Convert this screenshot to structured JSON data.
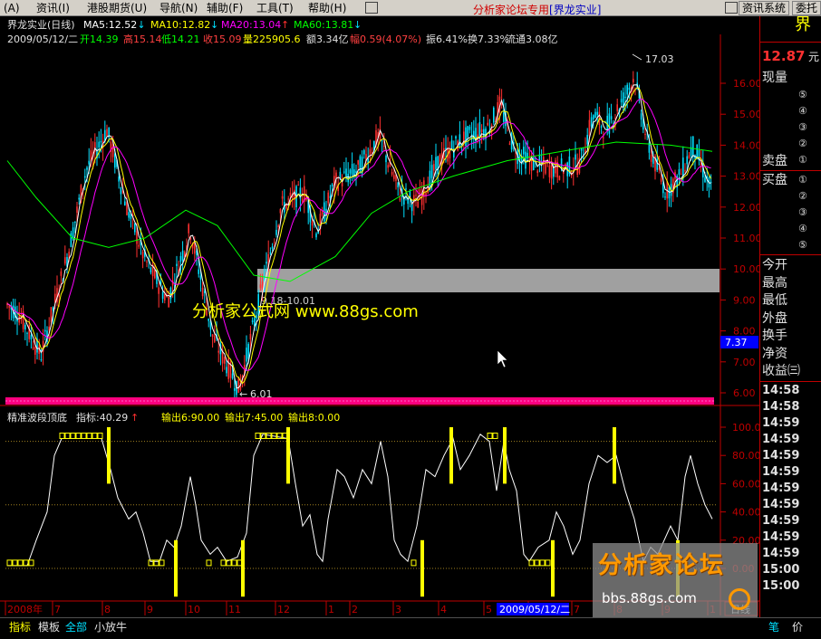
{
  "menubar": {
    "items": [
      {
        "key": "A",
        "label": "(A)"
      },
      {
        "key": "I",
        "label": "资讯(I)"
      },
      {
        "key": "U",
        "label": "港股期货(U)"
      },
      {
        "key": "N",
        "label": "导航(N)"
      },
      {
        "key": "F",
        "label": "辅助(F)"
      },
      {
        "key": "T",
        "label": "工具(T)"
      },
      {
        "key": "H",
        "label": "帮助(H)"
      }
    ],
    "title_main": "分析家论坛专用",
    "title_stock": "[界龙实业]",
    "btn_info": "资讯系统",
    "btn_delegate": "委托"
  },
  "header": {
    "stock_line": "界龙实业(日线)",
    "ma": [
      {
        "label": "MA5:12.52",
        "arrow": "↓",
        "color": "#ffffff"
      },
      {
        "label": "MA10:12.82",
        "arrow": "↓",
        "color": "#ffff00"
      },
      {
        "label": "MA20:13.04",
        "arrow": "↑",
        "color": "#ff00ff"
      },
      {
        "label": "MA60:13.81",
        "arrow": "↓",
        "color": "#00ff00"
      }
    ],
    "quote": [
      {
        "t": "2009/05/12/二",
        "c": "#e0e0e0"
      },
      {
        "t": "开14.39",
        "c": "#00ff00"
      },
      {
        "t": "高15.14",
        "c": "#ff4040"
      },
      {
        "t": "低14.21",
        "c": "#00ff00"
      },
      {
        "t": "收15.09",
        "c": "#ff4040"
      },
      {
        "t": "量225905.6",
        "c": "#ffff00"
      },
      {
        "t": "额3.34亿",
        "c": "#e0e0e0"
      },
      {
        "t": "幅0.59(4.07%)",
        "c": "#ff4040"
      },
      {
        "t": "振6.41%",
        "c": "#e0e0e0"
      },
      {
        "t": "换7.33%",
        "c": "#e0e0e0"
      },
      {
        "t": "流通3.08亿",
        "c": "#e0e0e0"
      }
    ]
  },
  "colors": {
    "up": "#ff3030",
    "down": "#00e0ff",
    "ma5": "#ffffff",
    "ma10": "#ffff00",
    "ma20": "#ff00ff",
    "ma60": "#00ff00",
    "indicator": "#ffff00"
  },
  "price_axis": [
    "16.00",
    "15.00",
    "14.00",
    "13.00",
    "12.00",
    "11.00",
    "10.00",
    "9.00",
    "8.00",
    "7.00",
    "6.00"
  ],
  "annotations": {
    "high_label": "17.03",
    "low_label": "6.01",
    "range_label": "9.18-10.01",
    "current_price_tag": "7.37",
    "watermark": "分析家公式网 www.88gs.com",
    "logo_text": "分析家论坛",
    "logo_url": "bbs.88gs.com"
  },
  "indicator": {
    "title": "精准波段顶底",
    "value": "指标:40.29",
    "arrow": "↑",
    "outputs": [
      "输出6:90.00",
      "输出7:45.00",
      "输出8:0.00"
    ],
    "axis": [
      "100.0",
      "80.00",
      "60.00",
      "40.00",
      "20.00",
      "0.00"
    ],
    "levels": [
      90,
      45,
      0
    ],
    "ylim": [
      0,
      105
    ]
  },
  "time_axis": [
    "2008年",
    "7",
    "8",
    "9",
    "10",
    "11",
    "12",
    "1",
    "2",
    "3",
    "4",
    "5",
    "6",
    "7",
    "8",
    "9",
    "1"
  ],
  "time_axis_highlight": "2009/05/12/二",
  "time_axis_btn": "日线",
  "side": {
    "name": "界",
    "price": "12.87",
    "unit": "元",
    "label_now": "现量",
    "sell_label": "卖盘",
    "buy_label": "买盘",
    "sell_nums": [
      "⑤",
      "④",
      "③",
      "②",
      "①"
    ],
    "buy_nums": [
      "①",
      "②",
      "③",
      "④",
      "⑤"
    ],
    "stats": [
      "今开",
      "最高",
      "最低",
      "外盘",
      "换手",
      "净资",
      "收益㈢"
    ],
    "ticks": [
      "14:58",
      "14:58",
      "14:59",
      "14:59",
      "14:59",
      "14:59",
      "14:59",
      "14:59",
      "14:59",
      "14:59",
      "14:59",
      "15:00",
      "15:00"
    ]
  },
  "tabs": [
    "指标",
    "模板",
    "全部",
    "小放牛"
  ],
  "tabs_right": [
    "笔",
    "价"
  ]
}
